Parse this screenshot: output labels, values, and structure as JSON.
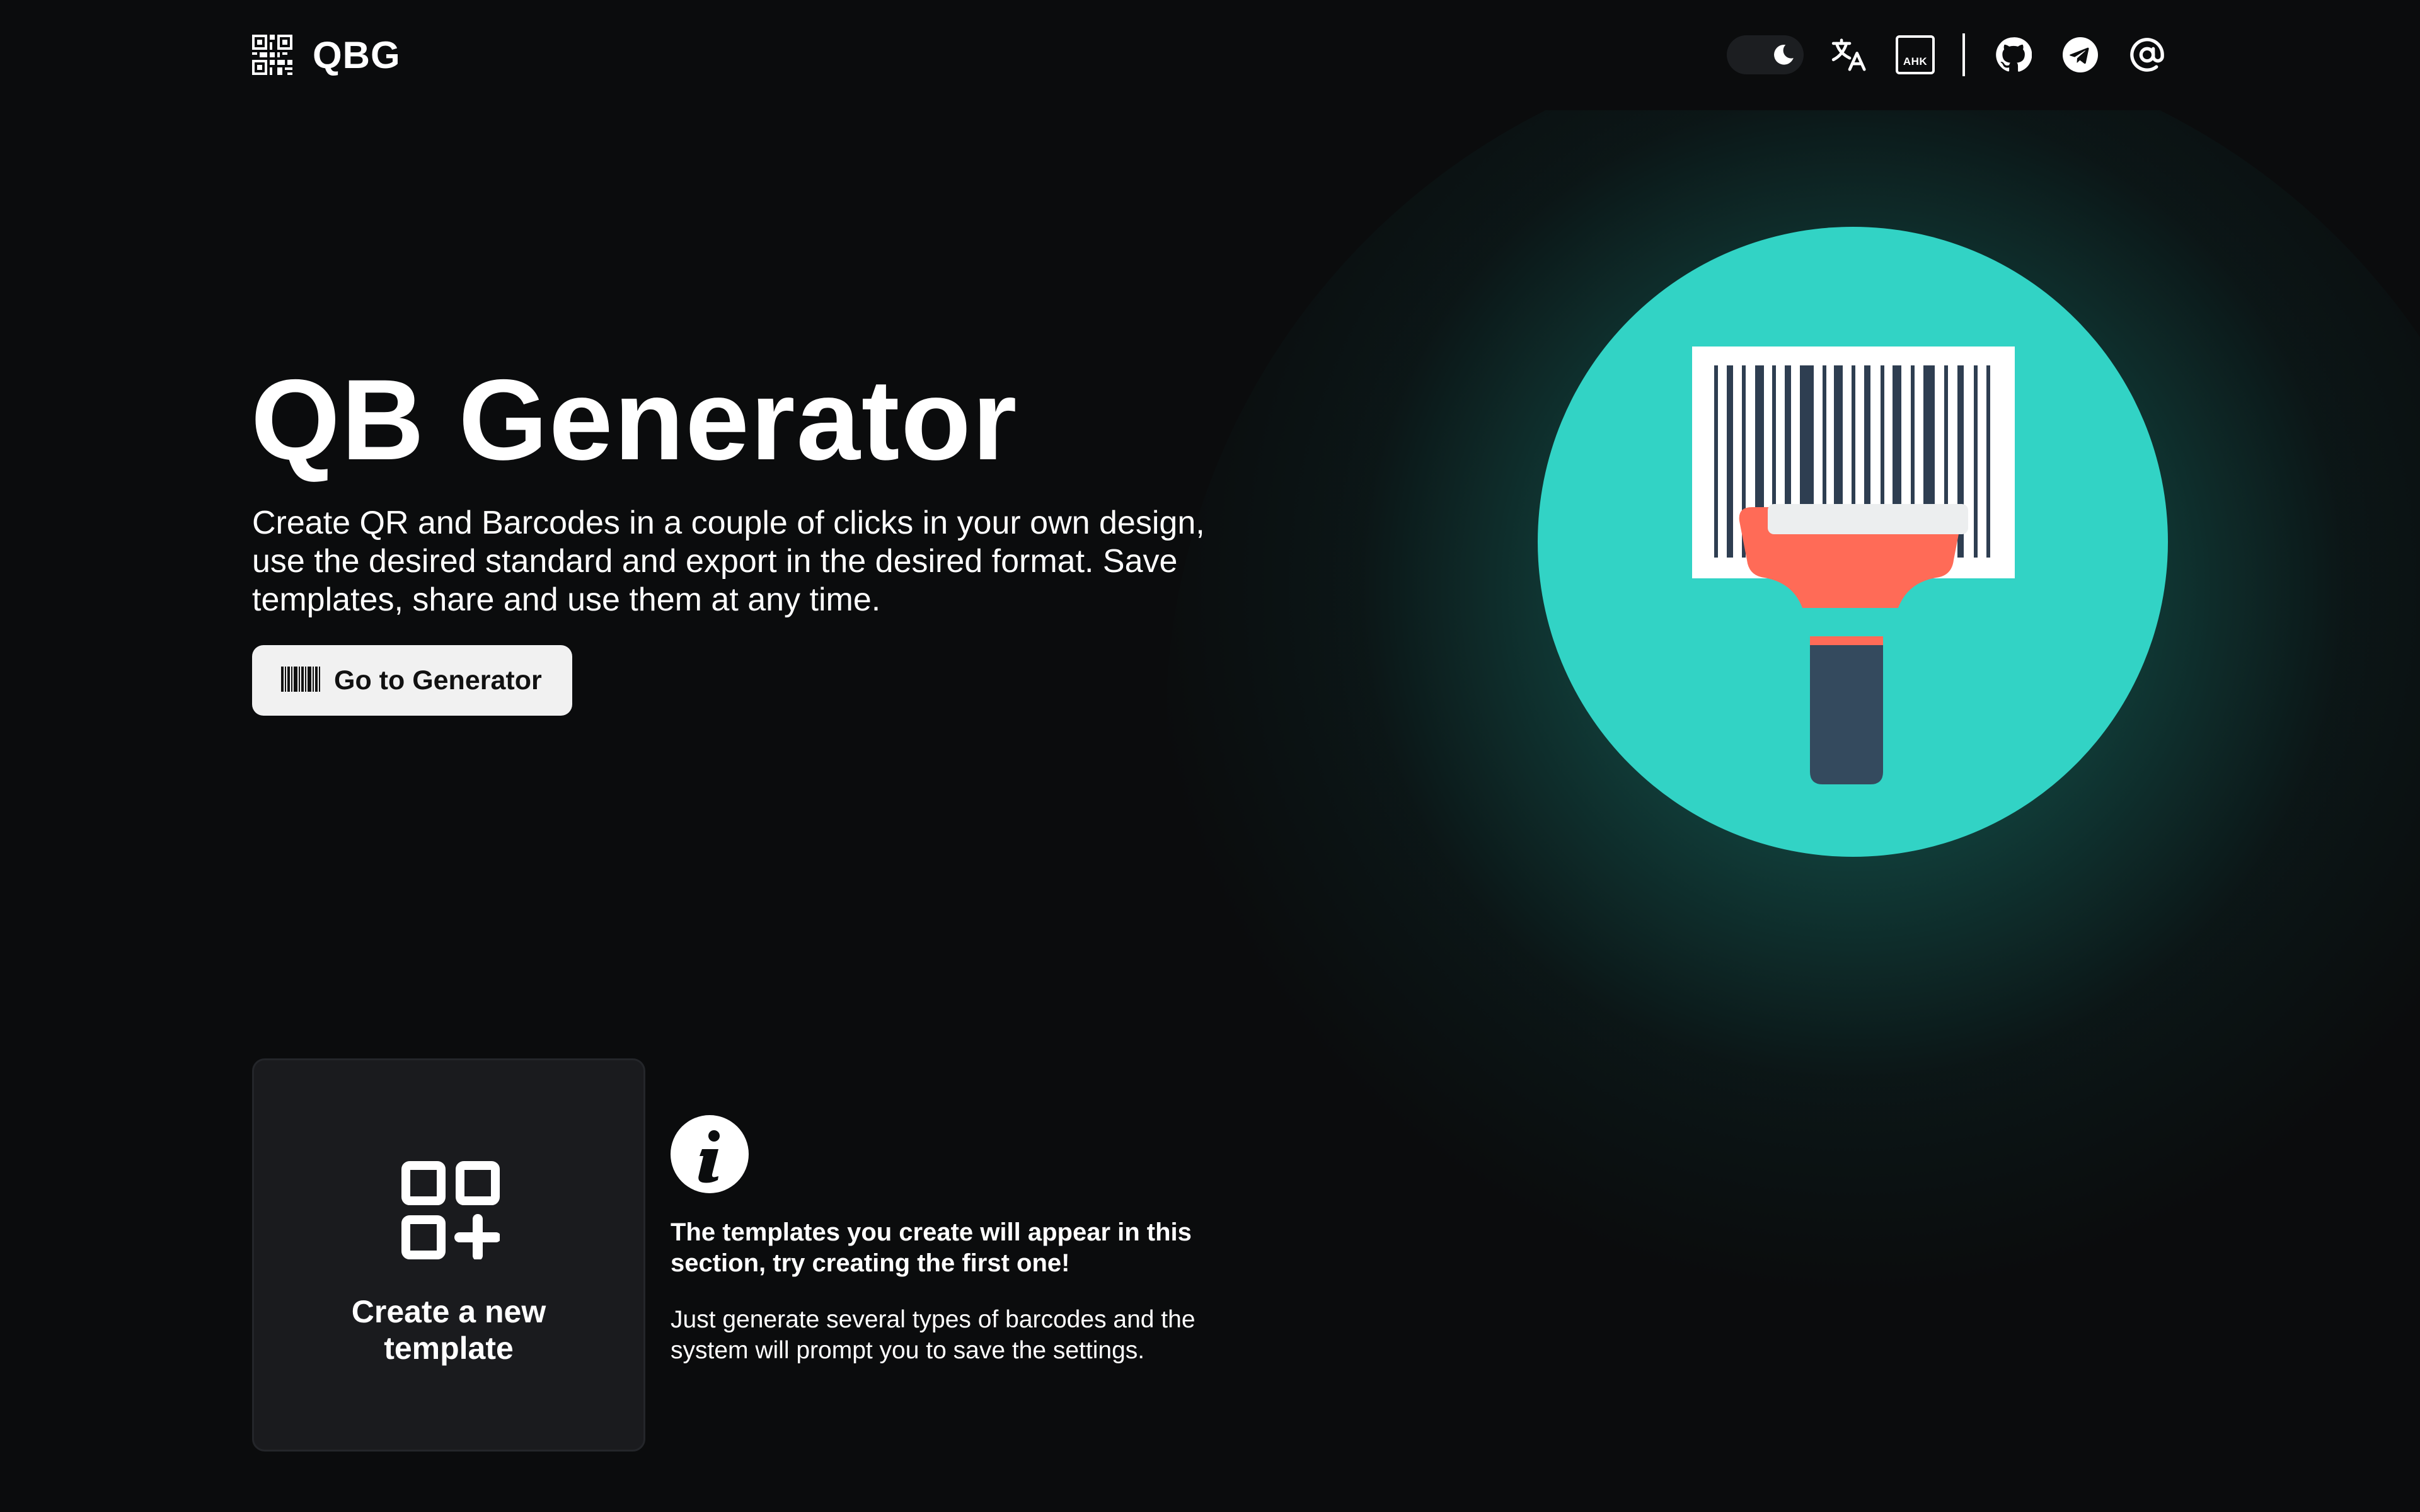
{
  "header": {
    "brand": "QBG",
    "logo_icon": "qr-code-icon",
    "theme_toggle": {
      "icon": "moon-icon",
      "state": "dark"
    },
    "language_icon": "translate-icon",
    "ahk_label": "AHK",
    "github_icon": "github-icon",
    "telegram_icon": "telegram-icon",
    "email_icon": "at-sign-icon"
  },
  "hero": {
    "title": "QB Generator",
    "description": "Create QR and Barcodes in a couple of clicks in your own design, use the desired standard and export in the desired format. Save templates, share and use them at any time.",
    "button_label": "Go to Generator",
    "button_icon": "barcode-icon",
    "illustration": "barcode-scanner-illustration"
  },
  "templates": {
    "new_template_label": "Create a new template",
    "new_template_icon": "add-template-icon",
    "info_icon": "info-icon",
    "info_title": "The templates you create will appear in this section, try creating the first one!",
    "info_text": "Just generate several types of barcodes and the system will prompt you to save the settings."
  },
  "colors": {
    "background": "#0b0c0d",
    "accent": "#32d3c5",
    "scanner_red": "#ff6b57",
    "scanner_handle": "#344a5e",
    "card_bg": "#1a1b1e",
    "button_bg": "#f1f1f1"
  }
}
